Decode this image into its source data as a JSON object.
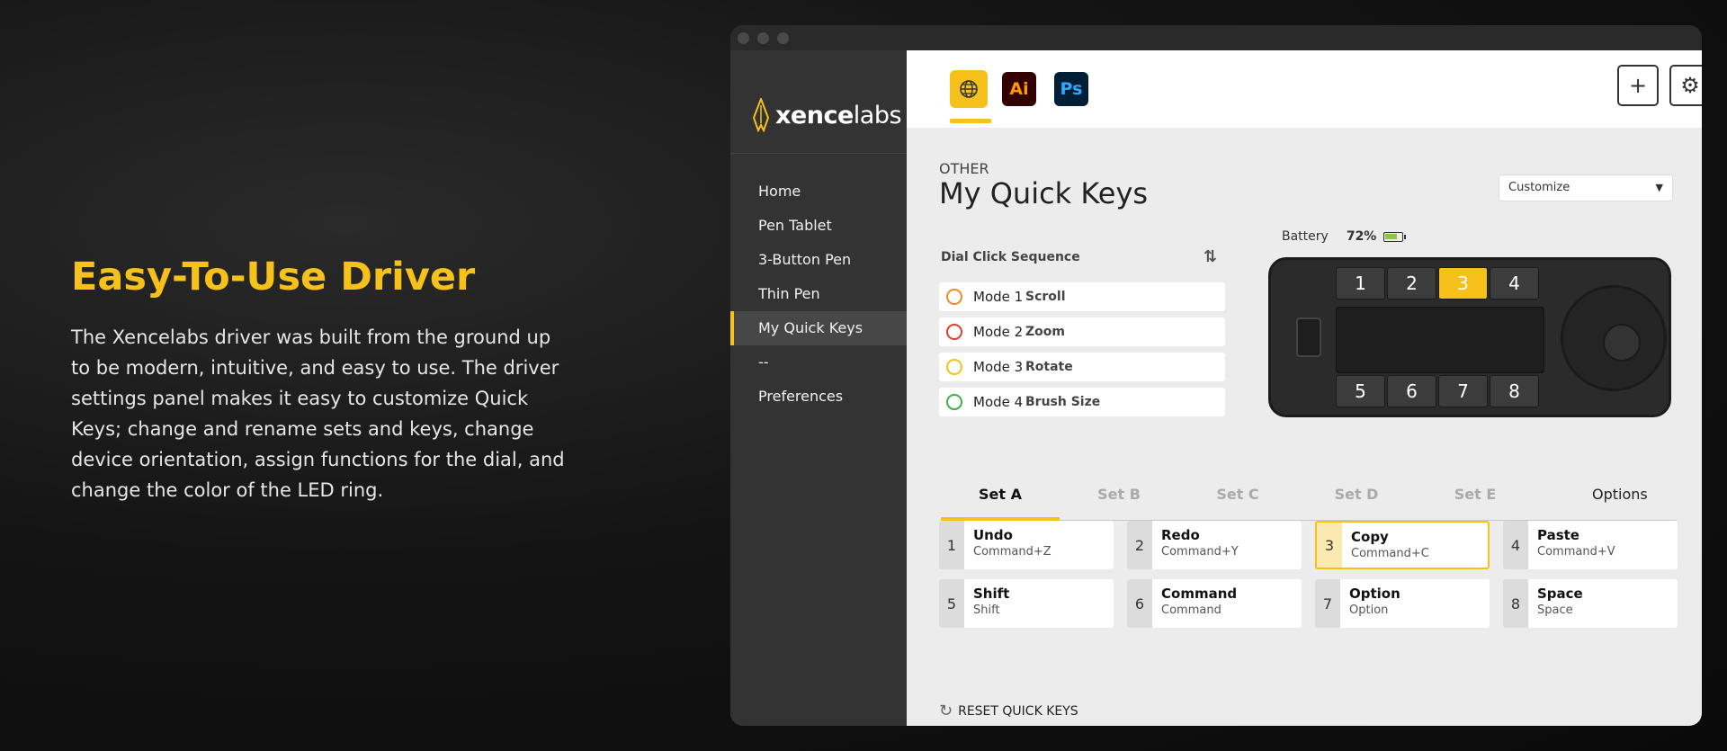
{
  "hero": {
    "title": "Easy-To-Use Driver",
    "body": "The Xencelabs driver was built from the ground up to be modern, intuitive, and easy to use. The driver settings panel makes it easy to customize Quick Keys; change and rename sets and keys, change device orientation, assign functions for the dial, and change the color of the LED ring."
  },
  "logo": {
    "bold": "xence",
    "light": "labs"
  },
  "nav": [
    "Home",
    "Pen Tablet",
    "3-Button Pen",
    "Thin Pen",
    "My Quick Keys",
    "--",
    "Preferences"
  ],
  "nav_active": "My Quick Keys",
  "app_tabs": {
    "ai": "Ai",
    "ps": "Ps"
  },
  "icons": {
    "add": "+",
    "settings": "⚙",
    "globe": "🌐"
  },
  "header": {
    "section": "OTHER",
    "title": "My Quick Keys"
  },
  "customize": {
    "value": "Customize"
  },
  "dial": {
    "title": "Dial Click Sequence",
    "modes": [
      {
        "name": "Mode 1",
        "func": "Scroll",
        "color": "#f08a24"
      },
      {
        "name": "Mode 2",
        "func": "Zoom",
        "color": "#e0402b"
      },
      {
        "name": "Mode 3",
        "func": "Rotate",
        "color": "#f5c11a"
      },
      {
        "name": "Mode 4",
        "func": "Brush Size",
        "color": "#3cb043"
      }
    ]
  },
  "battery": {
    "label": "Battery",
    "percent": "72%"
  },
  "device": {
    "top": [
      "1",
      "2",
      "3",
      "4"
    ],
    "bottom": [
      "5",
      "6",
      "7",
      "8"
    ],
    "lit": "3"
  },
  "sets": [
    "Set A",
    "Set B",
    "Set C",
    "Set D",
    "Set E"
  ],
  "options_label": "Options",
  "keys": [
    {
      "num": "1",
      "name": "Undo",
      "shortcut": "Command+Z"
    },
    {
      "num": "2",
      "name": "Redo",
      "shortcut": "Command+Y"
    },
    {
      "num": "3",
      "name": "Copy",
      "shortcut": "Command+C"
    },
    {
      "num": "4",
      "name": "Paste",
      "shortcut": "Command+V"
    },
    {
      "num": "5",
      "name": "Shift",
      "shortcut": "Shift"
    },
    {
      "num": "6",
      "name": "Command",
      "shortcut": "Command"
    },
    {
      "num": "7",
      "name": "Option",
      "shortcut": "Option"
    },
    {
      "num": "8",
      "name": "Space",
      "shortcut": "Space"
    }
  ],
  "reset_label": "RESET QUICK KEYS",
  "colors": {
    "accent": "#f5c11a",
    "sidebar": "#333333",
    "panel": "#ececec"
  }
}
